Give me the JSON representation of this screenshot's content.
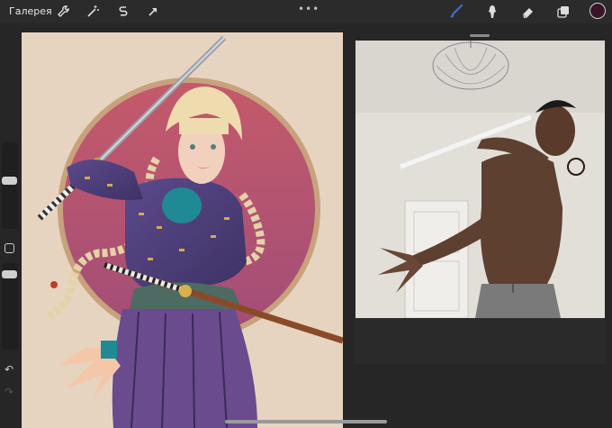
{
  "toolbar": {
    "gallery_label": "Галерея",
    "more_glyph": "•••",
    "icons": [
      "wrench-icon",
      "magic-wand-icon",
      "selection-s-icon",
      "transform-arrow-icon",
      "brush-icon",
      "smudge-icon",
      "eraser-icon",
      "layers-icon"
    ],
    "active_tool": "brush",
    "color": "#3a1428"
  },
  "sidebar": {
    "undo_glyph": "↶",
    "redo_glyph": "↷"
  },
  "colors": {
    "canvas_bg": "#e8d6c2",
    "sun_disc": "#b9566c",
    "accent_blue": "#3d6fd6"
  }
}
